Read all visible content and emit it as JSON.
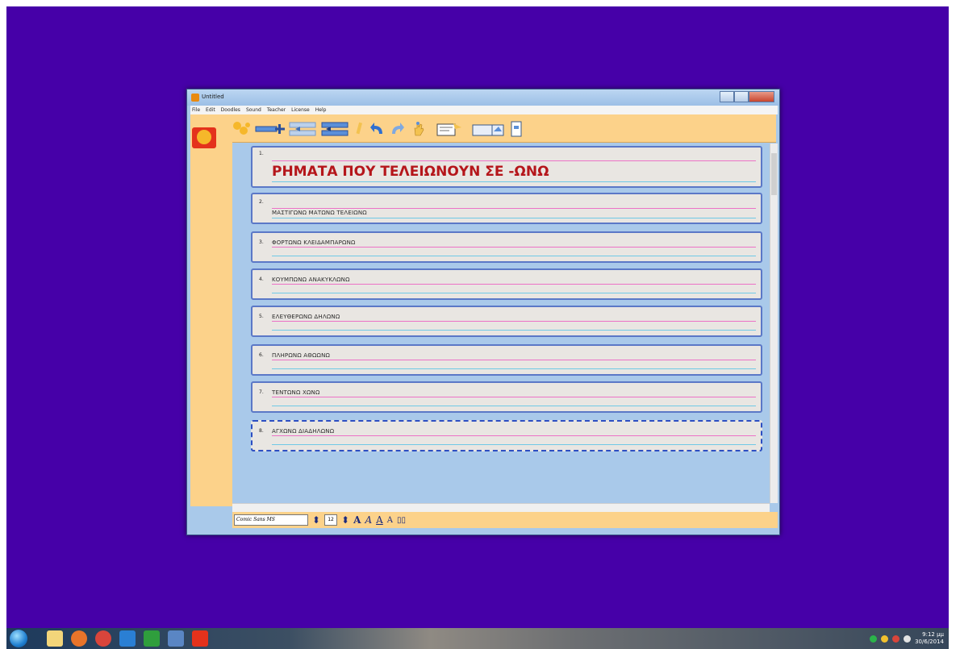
{
  "window": {
    "title": "Untitled"
  },
  "menu": [
    "File",
    "Edit",
    "Doodles",
    "Sound",
    "Teacher",
    "License",
    "Help"
  ],
  "toolbar_tools": [
    "people-icon",
    "add-line-icon",
    "insert-line-above-icon",
    "insert-line-below-icon",
    "pencil-icon",
    "undo-icon",
    "redo-icon",
    "hand-icon",
    "picture-icon",
    "book-icon",
    "document-icon"
  ],
  "lines": [
    {
      "num": "1.",
      "text": "ΡΗΜΑΤΑ ΠΟΥ ΤΕΛΕΙΩΝΟΥΝ ΣΕ -ΩΝΩ",
      "heading": true
    },
    {
      "num": "2.",
      "text": "ΜΑΣΤΙΓΩΝΩ ΜΑΤΩΝΩ ΤΕΛΕΙΩΝΩ"
    },
    {
      "num": "3.",
      "text": "ΦΟΡΤΩΝΩ ΚΛΕΙΔΑΜΠΑΡΩΝΩ"
    },
    {
      "num": "4.",
      "text": "ΚΟΥΜΠΩΝΩ ΑΝΑΚΥΚΛΩΝΩ"
    },
    {
      "num": "5.",
      "text": "ΕΛΕΥΘΕΡΩΝΩ ΔΗΛΩΝΩ"
    },
    {
      "num": "6.",
      "text": "ΠΛΗΡΩΝΩ ΑΘΩΩΝΩ"
    },
    {
      "num": "7.",
      "text": "ΤΕΝΤΩΝΩ ΧΩΝΩ"
    },
    {
      "num": "8.",
      "text": "ΑΓΧΩΝΩ ΔΙΑΔΗΛΩΝΩ"
    }
  ],
  "statusbar": {
    "font": "Comic Sans MS",
    "size": "12"
  },
  "taskbar": {
    "time": "9:12 μμ",
    "date": "30/6/2014"
  },
  "colors": {
    "desktop": "#4600a8",
    "toolbar": "#fcd28a",
    "page": "#a9c9ea",
    "heading": "#b5161b"
  }
}
